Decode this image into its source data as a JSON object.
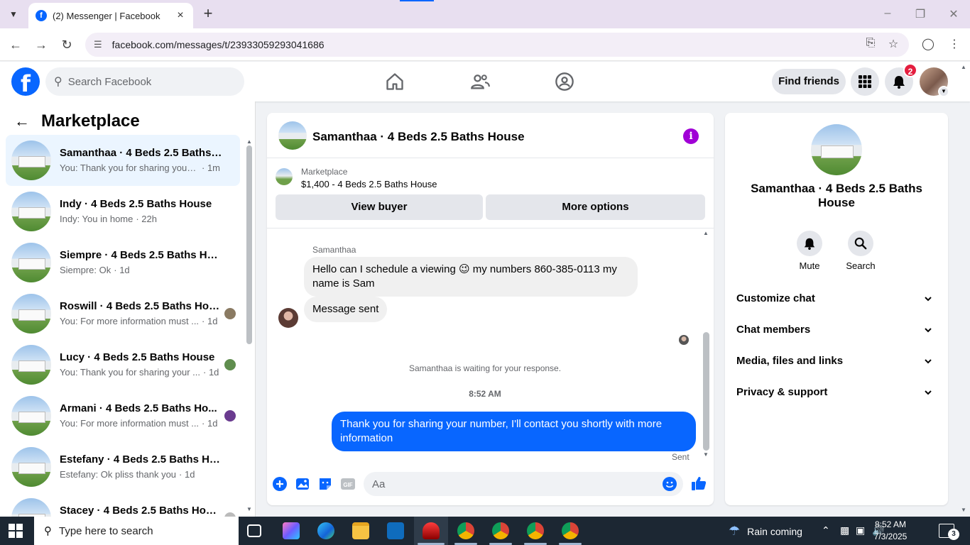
{
  "browser": {
    "tab_title": "(2) Messenger | Facebook",
    "url": "facebook.com/messages/t/23933059293041686"
  },
  "header": {
    "search_placeholder": "Search Facebook",
    "find_friends_label": "Find friends",
    "notification_count": "2"
  },
  "sidebar": {
    "title": "Marketplace",
    "conversations": [
      {
        "name": "Samanthaa · 4 Beds 2.5 Baths H...",
        "snippet": "You: Thank you for sharing your nu...",
        "time": "· 1m",
        "active": true
      },
      {
        "name": "Indy · 4 Beds 2.5 Baths House",
        "snippet": "Indy: You in home",
        "time": "· 22h"
      },
      {
        "name": "Siempre · 4 Beds 2.5 Baths House",
        "snippet": "Siempre: Ok",
        "time": "· 1d"
      },
      {
        "name": "Roswill · 4 Beds 2.5 Baths Hou...",
        "snippet": "You: For more information must ...",
        "time": "· 1d"
      },
      {
        "name": "Lucy · 4 Beds 2.5 Baths House",
        "snippet": "You: Thank you for sharing your ...",
        "time": "· 1d"
      },
      {
        "name": "Armani · 4 Beds 2.5 Baths Ho...",
        "snippet": "You: For more information must ...",
        "time": "· 1d"
      },
      {
        "name": "Estefany · 4 Beds 2.5 Baths House",
        "snippet": "Estefany: Ok pliss thank you",
        "time": "· 1d"
      },
      {
        "name": "Stacey · 4 Beds 2.5 Baths House",
        "snippet": "",
        "time": ""
      }
    ]
  },
  "chat": {
    "title": "Samanthaa · 4 Beds 2.5 Baths House",
    "listing_category": "Marketplace",
    "listing_price": "$1,400 - 4 Beds 2.5 Baths House",
    "view_buyer_label": "View buyer",
    "more_options_label": "More options",
    "sender_name": "Samanthaa",
    "incoming_message": "Hello can I schedule a viewing 😉 my numbers 860-385-0113 my name is Sam",
    "incoming_message_2": "Message sent",
    "waiting_text": "Samanthaa is waiting for your response.",
    "timestamp": "8:52 AM",
    "outgoing_message": "Thank you for sharing your number, I'll contact you shortly with more information",
    "sent_label": "Sent",
    "composer_placeholder": "Aa"
  },
  "right_panel": {
    "name": "Samanthaa · 4 Beds 2.5 Baths House",
    "mute_label": "Mute",
    "search_label": "Search",
    "sections": [
      "Customize chat",
      "Chat members",
      "Media, files and links",
      "Privacy & support"
    ]
  },
  "taskbar": {
    "search_placeholder": "Type here to search",
    "weather": "Rain coming",
    "time": "8:52 AM",
    "date": "7/3/2025",
    "notification_count": "3"
  },
  "colors": {
    "brand": "#0866ff",
    "info_purple": "#a000d6",
    "badge_red": "#e41e3f"
  }
}
